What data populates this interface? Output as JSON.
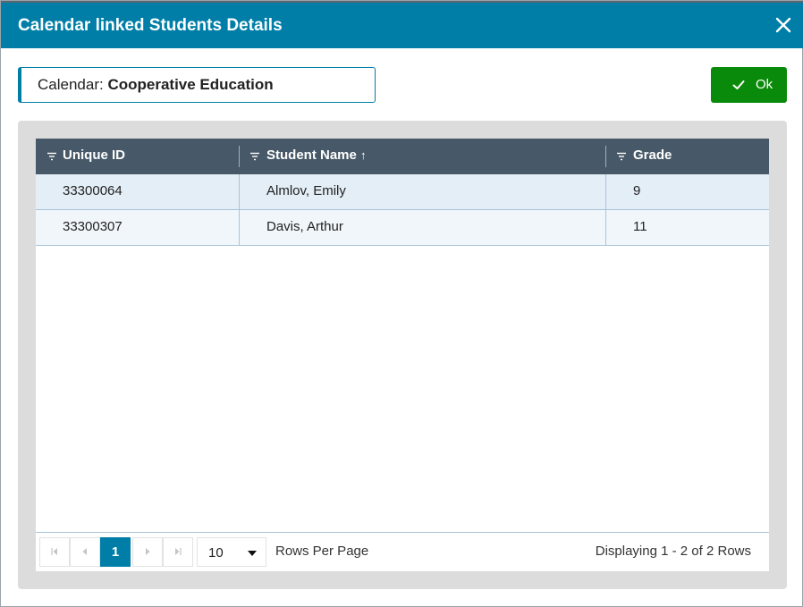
{
  "dialog": {
    "title": "Calendar linked Students Details",
    "close_icon": "close-icon"
  },
  "calendar": {
    "label": "Calendar:",
    "value": "Cooperative Education"
  },
  "ok_button": {
    "label": "Ok",
    "icon": "check-icon"
  },
  "grid": {
    "columns": [
      {
        "label": "Unique ID",
        "filter_icon": "filter-icon"
      },
      {
        "label": "Student Name",
        "filter_icon": "filter-icon",
        "sort": "↑"
      },
      {
        "label": "Grade",
        "filter_icon": "filter-icon"
      }
    ],
    "rows": [
      {
        "unique_id": "33300064",
        "student_name": "Almlov, Emily",
        "grade": "9"
      },
      {
        "unique_id": "33300307",
        "student_name": "Davis, Arthur",
        "grade": "11"
      }
    ]
  },
  "pager": {
    "current_page": "1",
    "page_size": "10",
    "rows_per_page_label": "Rows Per Page",
    "display_info": "Displaying 1 - 2 of 2 Rows",
    "first_icon": "first-page-icon",
    "prev_icon": "prev-page-icon",
    "next_icon": "next-page-icon",
    "last_icon": "last-page-icon"
  },
  "colors": {
    "titlebar": "#007ea7",
    "ok_button": "#0a8a0a",
    "grid_header": "#475968"
  }
}
